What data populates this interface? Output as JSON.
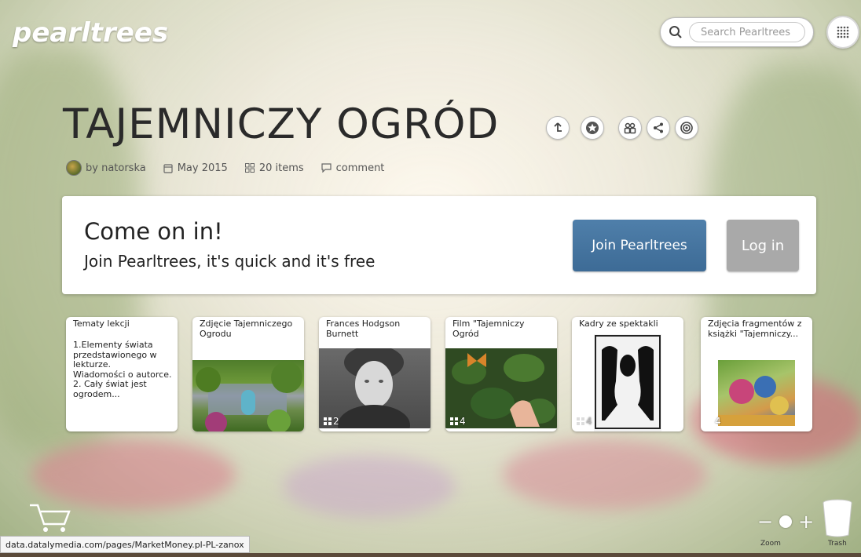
{
  "app": {
    "logo": "pearltrees"
  },
  "search": {
    "placeholder": "Search Pearltrees"
  },
  "collection": {
    "title": "TAJEMNICZY OGRÓD",
    "author": "by natorska",
    "date": "May 2015",
    "items": "20 items",
    "comment": "comment"
  },
  "join": {
    "heading": "Come on in!",
    "subheading": "Join Pearltrees, it's quick and it's free",
    "join_label": "Join Pearltrees",
    "login_label": "Log in"
  },
  "pearls": [
    {
      "title": "Tematy lekcji",
      "body": "1.Elementy świata przedstawionego w lekturze.\nWiadomości o autorce.\n2. Cały świat jest ogrodem..."
    },
    {
      "title": "Zdjęcie Tajemniczego Ogrodu"
    },
    {
      "title": "Frances Hodgson Burnett",
      "count": "2"
    },
    {
      "title": "Film \"Tajemniczy Ogród",
      "count": "4"
    },
    {
      "title": "Kadry ze spektakli",
      "count": "4"
    },
    {
      "title": "Zdjęcia fragmentów z książki \"Tajemniczy...",
      "count": "4"
    }
  ],
  "bottom": {
    "zoom_label": "Zoom",
    "trash_label": "Trash",
    "status_url": "data.datalymedia.com/pages/MarketMoney.pl-PL-zanox"
  }
}
